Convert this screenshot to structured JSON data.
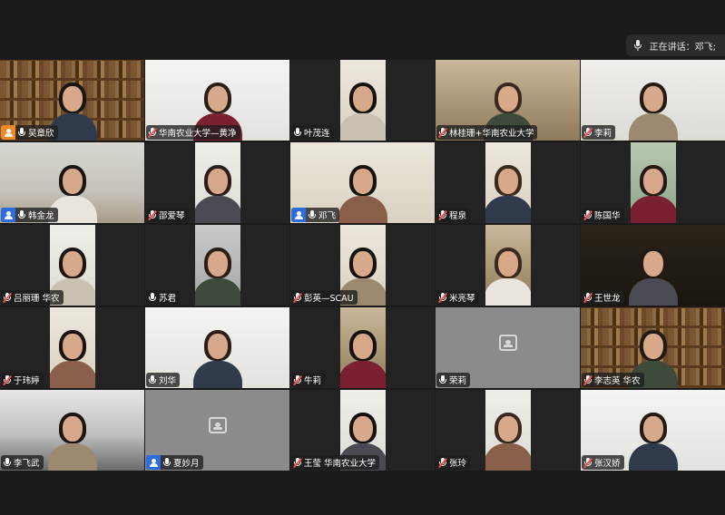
{
  "speaker_bar": {
    "text": "正在讲话：邓飞;"
  },
  "colors": {
    "host_badge": "#f08a24",
    "cohost_badge": "#2d6cdf",
    "active_border": "#2fbf57",
    "muted_mic": "#ff4d4d"
  },
  "participants": [
    {
      "name": "吴章欣",
      "badge": "host",
      "muted": false,
      "bg": "shelf"
    },
    {
      "name": "华南农业大学—黄净",
      "badge": "",
      "muted": true,
      "bg": "bright"
    },
    {
      "name": "叶茂连",
      "badge": "",
      "muted": false,
      "bg": "cream"
    },
    {
      "name": "林桂珊+华南农业大学",
      "badge": "",
      "muted": true,
      "bg": "warm"
    },
    {
      "name": "李莉",
      "badge": "",
      "muted": true,
      "bg": "wall"
    },
    {
      "name": "韩金龙",
      "badge": "cohost",
      "muted": false,
      "bg": "room"
    },
    {
      "name": "邵爱琴",
      "badge": "",
      "muted": true,
      "bg": "wall"
    },
    {
      "name": "邓飞",
      "badge": "cohost",
      "muted": false,
      "bg": "cream",
      "active": true
    },
    {
      "name": "程泉",
      "badge": "",
      "muted": true,
      "bg": "cream"
    },
    {
      "name": "陈国华",
      "badge": "",
      "muted": true,
      "bg": "green"
    },
    {
      "name": "吕丽珊 华农",
      "badge": "",
      "muted": true,
      "bg": "wall"
    },
    {
      "name": "苏君",
      "badge": "",
      "muted": false,
      "bg": "gray"
    },
    {
      "name": "彭英—SCAU",
      "badge": "",
      "muted": true,
      "bg": "cream"
    },
    {
      "name": "米亮琴",
      "badge": "",
      "muted": true,
      "bg": "warm"
    },
    {
      "name": "王世龙",
      "badge": "",
      "muted": true,
      "bg": "dark"
    },
    {
      "name": "于玮婷",
      "badge": "",
      "muted": true,
      "bg": "cream"
    },
    {
      "name": "刘华",
      "badge": "",
      "muted": false,
      "bg": "bright"
    },
    {
      "name": "牛莉",
      "badge": "",
      "muted": true,
      "bg": "warm"
    },
    {
      "name": "荣莉",
      "badge": "",
      "muted": false,
      "bg": "none"
    },
    {
      "name": "李志英 华农",
      "badge": "",
      "muted": true,
      "bg": "shelf"
    },
    {
      "name": "李飞武",
      "badge": "",
      "muted": false,
      "bg": "office"
    },
    {
      "name": "夏妙月",
      "badge": "cohost",
      "muted": false,
      "bg": "none"
    },
    {
      "name": "王莹 华南农业大学",
      "badge": "",
      "muted": true,
      "bg": "wall"
    },
    {
      "name": "张玲",
      "badge": "",
      "muted": true,
      "bg": "wall"
    },
    {
      "name": "张汉娇",
      "badge": "",
      "muted": true,
      "bg": "bright"
    }
  ]
}
